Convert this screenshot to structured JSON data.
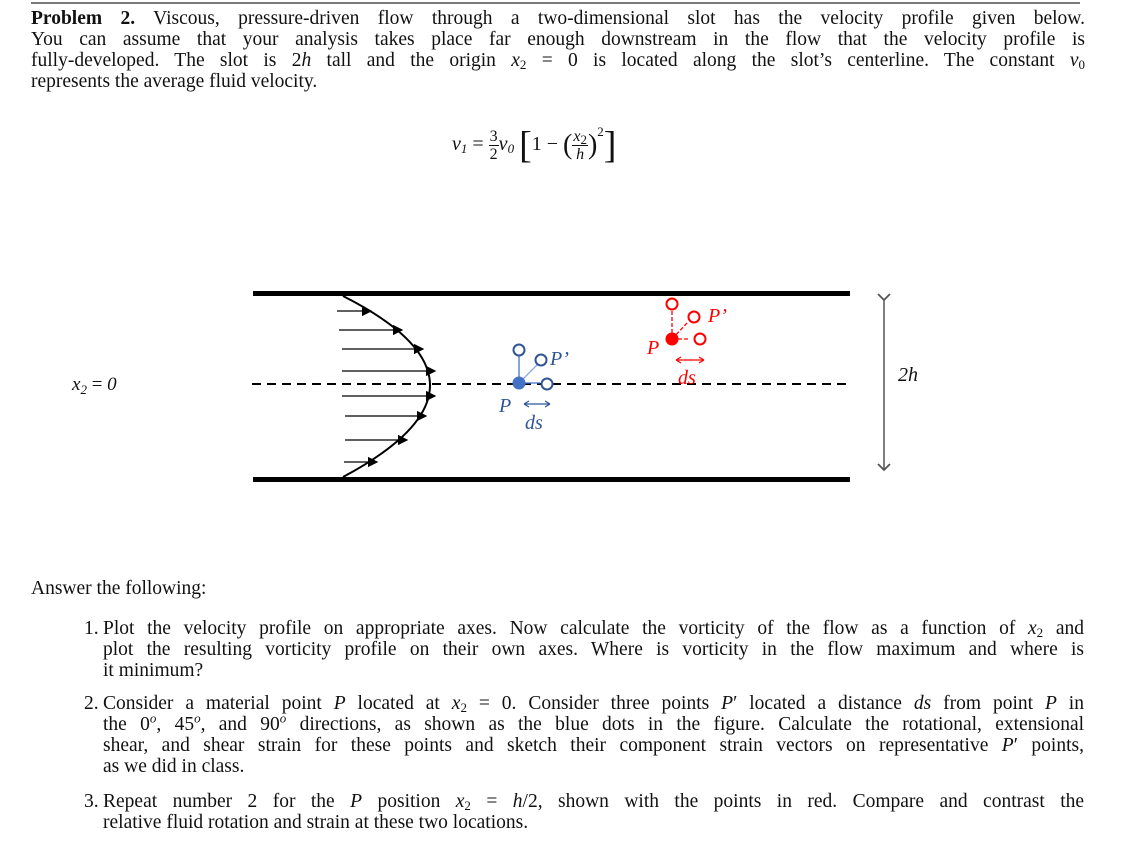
{
  "problem": {
    "title": "Problem 2.",
    "intro_lines": [
      "Viscous, pressure-driven flow through a two-dimensional slot has the velocity profile given below.",
      "You can assume that your analysis takes place far enough downstream in the flow that the velocity profile is",
      "fully-developed. The slot is 2h tall and the origin x2 = 0 is located along the slot’s centerline. The constant v0",
      "represents the average fluid velocity."
    ],
    "equation": {
      "lhs": "v1",
      "coef_num": "3",
      "coef_den": "2",
      "mean_velocity": "v0",
      "bracket_text": "1 −",
      "ratio_num": "x2",
      "ratio_den": "h",
      "exponent": "2"
    }
  },
  "figure": {
    "centerline_label": "x₂ = 0",
    "height_label": "2h",
    "blue_point_label": "P",
    "blue_prime_label": "P’",
    "blue_ds_label": "ds",
    "red_point_label": "P",
    "red_prime_label": "P’",
    "red_ds_label": "ds",
    "colors": {
      "walls": "#000000",
      "blue": "#4472c4",
      "blue_text": "#2f5597",
      "red": "#ff0000",
      "dimension_arrow": "#555555"
    },
    "velocity_arrow_count": 8
  },
  "questions": {
    "heading": "Answer the following:",
    "items": [
      {
        "number": "1.",
        "lines": [
          "Plot the velocity profile on appropriate axes. Now calculate the vorticity of the flow as a function of x2 and",
          "plot the resulting vorticity profile on their own axes. Where is vorticity in the flow maximum and where is",
          "it minimum?"
        ]
      },
      {
        "number": "2.",
        "lines": [
          "Consider a material point P located at x2 = 0. Consider three points P′ located a distance ds from point P in",
          "the 0°, 45°, and 90° directions, as shown as the blue dots in the figure. Calculate the rotational, extensional",
          "shear, and shear strain for these points and sketch their component strain vectors on representative P′ points,",
          "as we did in class."
        ]
      },
      {
        "number": "3.",
        "lines": [
          "Repeat number 2 for the P position x2 = h/2, shown with the points in red. Compare and contrast the",
          "relative fluid rotation and strain at these two locations."
        ]
      }
    ]
  }
}
